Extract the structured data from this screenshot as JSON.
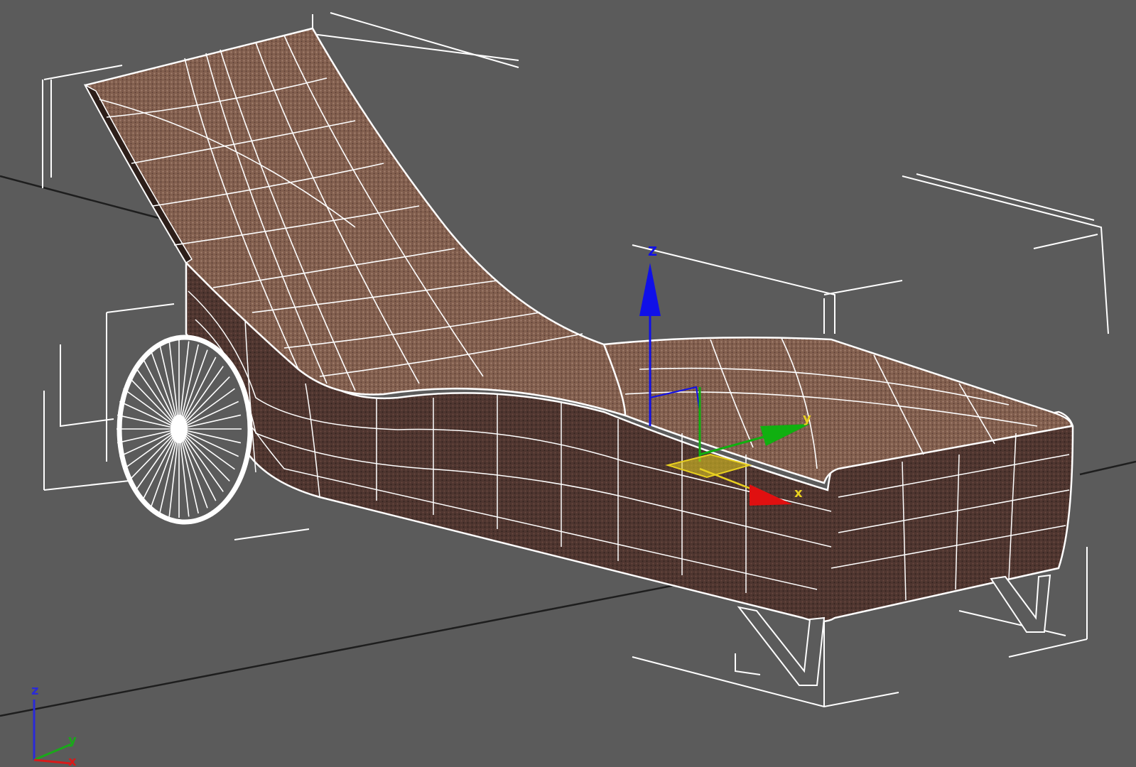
{
  "viewport": {
    "background_color": "#5b5b5b",
    "grid_line_color": "#1e1e1e",
    "wire_color": "#ffffff",
    "fabric_color": "#8a6357",
    "fabric_dark_color": "#4e342d"
  },
  "gizmo": {
    "z_label": "Z",
    "y_label": "y",
    "x_label": "x",
    "z_color": "#1010e8",
    "y_color": "#10b010",
    "x_color": "#e01010",
    "plane_color": "#e8d020"
  },
  "axis_tripod": {
    "z_label": "z",
    "y_label": "y",
    "x_label": "x",
    "z_color": "#2a2ad8",
    "y_color": "#1aa81a",
    "x_color": "#d81a1a"
  },
  "icons": {
    "transform_gizmo": "move-gizmo-icon",
    "world_axis": "axis-tripod-icon"
  }
}
